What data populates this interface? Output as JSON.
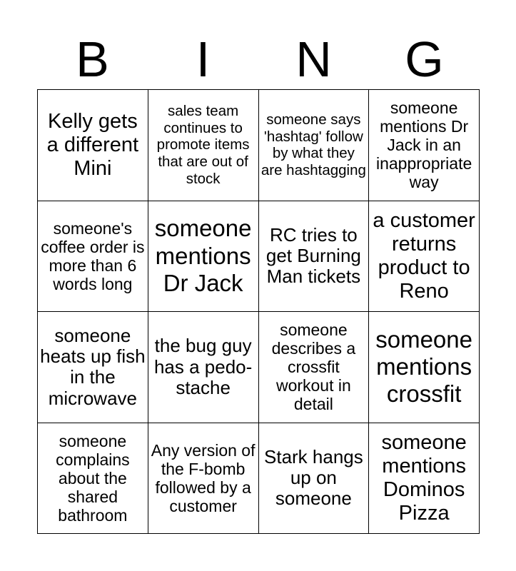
{
  "card": {
    "header_letters": [
      "B",
      "I",
      "N",
      "G"
    ],
    "columns": 4,
    "rows": 4,
    "colors": {
      "background": "#ffffff",
      "text": "#000000",
      "grid_line": "#000000"
    },
    "cells": [
      {
        "text": "Kelly gets a different Mini",
        "size": "fs-lg"
      },
      {
        "text": "sales team continues to promote items that are out of stock",
        "size": "fs-xs"
      },
      {
        "text": "someone says 'hashtag' follow by what they are hashtagging",
        "size": "fs-xs"
      },
      {
        "text": "someone mentions Dr Jack in an inappropriate way",
        "size": "fs-sm"
      },
      {
        "text": "someone's coffee order is more than 6 words long",
        "size": "fs-sm"
      },
      {
        "text": "someone mentions Dr Jack",
        "size": "fs-xl"
      },
      {
        "text": "RC tries to get Burning Man tickets",
        "size": "fs-md"
      },
      {
        "text": "a customer returns product to Reno",
        "size": "fs-lg"
      },
      {
        "text": "someone heats up fish in the microwave",
        "size": "fs-md"
      },
      {
        "text": "the bug guy has a pedo-stache",
        "size": "fs-md"
      },
      {
        "text": "someone describes a crossfit workout in detail",
        "size": "fs-sm"
      },
      {
        "text": "someone mentions crossfit",
        "size": "fs-xl"
      },
      {
        "text": "someone complains about the shared bathroom",
        "size": "fs-sm"
      },
      {
        "text": "Any version of the F-bomb followed by a customer",
        "size": "fs-sm"
      },
      {
        "text": "Stark hangs up on someone",
        "size": "fs-md"
      },
      {
        "text": "someone mentions Dominos Pizza",
        "size": "fs-lg"
      }
    ]
  }
}
